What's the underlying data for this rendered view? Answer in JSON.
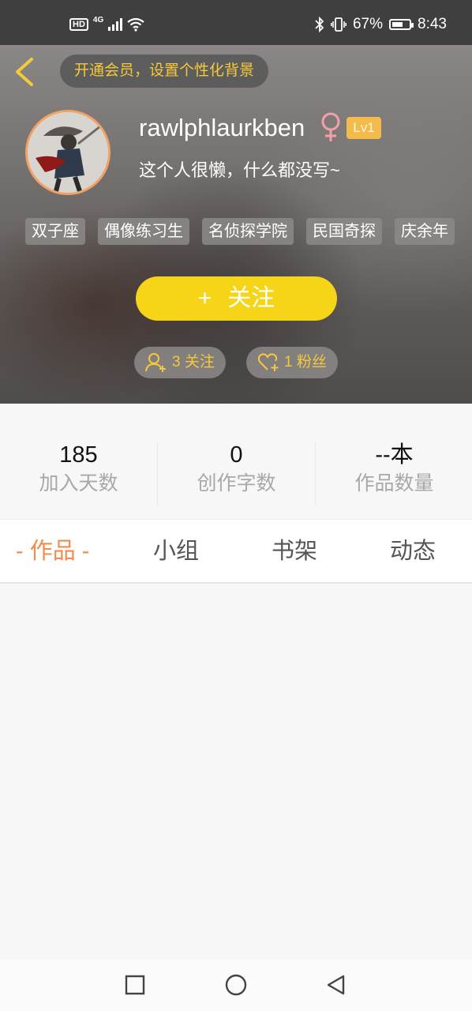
{
  "status_bar": {
    "hd": "HD",
    "network": "4G",
    "battery_percent": "67%",
    "battery_level": 0.67,
    "time": "8:43"
  },
  "header": {
    "vip_prompt": "开通会员，设置个性化背景",
    "username": "rawlphlaurkben",
    "gender_symbol": "♀",
    "level": "Lv1",
    "bio": "这个人很懒，什么都没写~",
    "tags": [
      "双子座",
      "偶像练习生",
      "名侦探学院",
      "民国奇探",
      "庆余年"
    ],
    "follow_button": {
      "plus": "+",
      "label": "关注"
    },
    "following": "3 关注",
    "followers": "1 粉丝"
  },
  "stats": [
    {
      "value": "185",
      "label": "加入天数"
    },
    {
      "value": "0",
      "label": "创作字数"
    },
    {
      "value": "--本",
      "label": "作品数量"
    }
  ],
  "tabs": [
    {
      "label": "- 作品 -",
      "active": true
    },
    {
      "label": "小组",
      "active": false
    },
    {
      "label": "书架",
      "active": false
    },
    {
      "label": "动态",
      "active": false
    }
  ],
  "colors": {
    "accent_orange": "#f28b4d",
    "follow_yellow": "#f6d519",
    "level_gold": "#f3bb4a",
    "gender_pink": "#f4a0a8"
  },
  "icons": {
    "back": "chevron-left-icon",
    "following": "user-plus-icon",
    "followers": "heart-plus-icon",
    "nav_recent": "square-icon",
    "nav_home": "circle-icon",
    "nav_back": "triangle-back-icon"
  }
}
